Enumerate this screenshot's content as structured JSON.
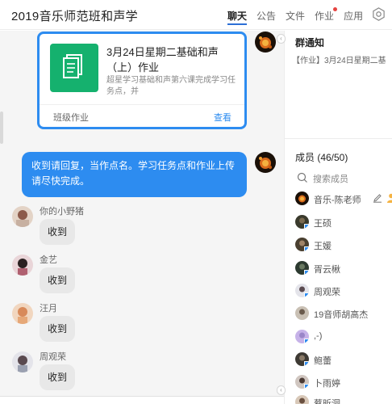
{
  "header": {
    "title": "2019音乐师范班和声学",
    "tabs": [
      {
        "label": "聊天",
        "active": true
      },
      {
        "label": "公告",
        "active": false
      },
      {
        "label": "文件",
        "active": false
      },
      {
        "label": "作业",
        "active": false,
        "has_dot": true
      },
      {
        "label": "应用",
        "active": false
      }
    ],
    "settings_icon": "gear-icon"
  },
  "chat": {
    "task_card": {
      "title": "3月24日星期二基础和声（上）作业",
      "description": "超星学习基础和声第六课完成学习任务点，并",
      "type_label": "班级作业",
      "view_label": "查看",
      "icon": "document-icon",
      "accent": "#15b16e"
    },
    "announcement": {
      "text": "收到请回复，当作点名。学习任务点和作业上传请尽快完成。",
      "bubble_color": "#2d8cf0"
    },
    "messages": [
      {
        "sender": "你的小野猪",
        "text": "收到"
      },
      {
        "sender": "金艺",
        "text": "收到"
      },
      {
        "sender": "汪月",
        "text": "收到"
      },
      {
        "sender": "周观荣",
        "text": "收到"
      }
    ]
  },
  "sidebar": {
    "collapse_glyph": "‹",
    "notice": {
      "title": "群通知",
      "text": "【作业】3月24日星期二基"
    },
    "members": {
      "title": "成员 (46/50)",
      "search_placeholder": "搜索成员",
      "list": [
        {
          "name": "音乐-陈老师",
          "owner": true
        },
        {
          "name": "王硕"
        },
        {
          "name": "王媛"
        },
        {
          "name": "胥云楸"
        },
        {
          "name": "周观荣"
        },
        {
          "name": "19音师胡高杰"
        },
        {
          "name": ",-)"
        },
        {
          "name": "鲍蕾"
        },
        {
          "name": "卜雨婷"
        },
        {
          "name": "蔡昕洞"
        }
      ]
    }
  }
}
